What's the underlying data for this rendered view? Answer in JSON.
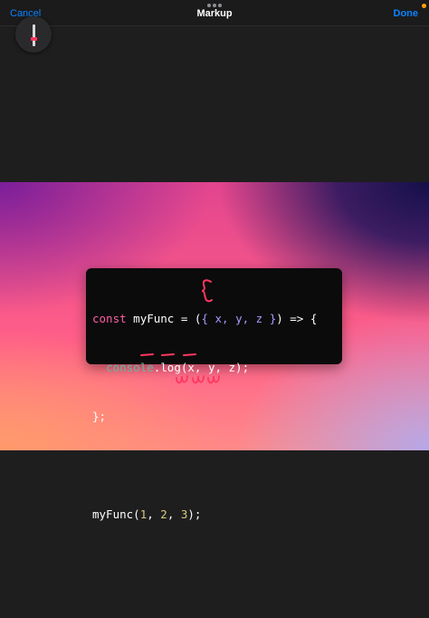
{
  "toolbar": {
    "cancel_label": "Cancel",
    "title": "Markup",
    "done_label": "Done"
  },
  "code": {
    "line1": {
      "keyword": "const",
      "name": " myFunc = ",
      "brace_open": "{",
      "params": " x, y, z ",
      "brace_close": "}",
      "arrow": ") => {"
    },
    "line2": {
      "indent": "  ",
      "object": "console",
      "call": ".log(x, y, z);"
    },
    "line3": "};",
    "line5": {
      "call_open": "myFunc(",
      "arg1": "1",
      "sep1": ", ",
      "arg2": "2",
      "sep2": ", ",
      "arg3": "3",
      "call_close": ");"
    }
  },
  "colors": {
    "accent": "#0a84ff",
    "ink": "#ff375f",
    "status_dot": "#ff9f0a"
  },
  "icons": {
    "grabber": "ellipsis-icon",
    "tool": "pen-tool-icon"
  }
}
